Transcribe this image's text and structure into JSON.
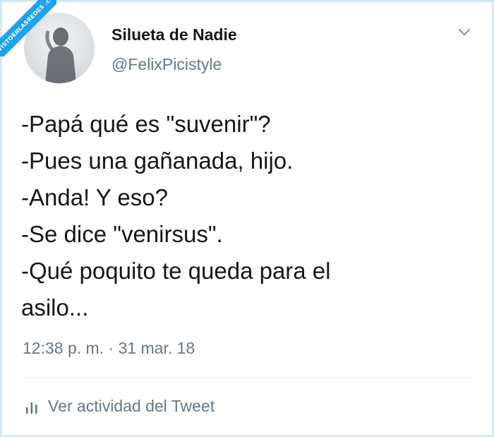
{
  "watermark": {
    "text": "VISTOENLASREDES .com"
  },
  "tweet": {
    "author_name": "Silueta de Nadie",
    "author_handle": "@FelixPicistyle",
    "lines": [
      "-Papá qué es \"suvenir\"?",
      "-Pues una gañanada, hijo.",
      "-Anda! Y eso?",
      "-Se dice \"venirsus\".",
      "-Qué poquito te queda para el",
      "asilo..."
    ],
    "timestamp": "12:38 p. m. · 31 mar. 18",
    "activity_label": "Ver actividad del Tweet",
    "menu_icon": "chevron-down-icon",
    "activity_icon": "analytics-bars-icon"
  },
  "colors": {
    "text_primary": "#14171a",
    "text_secondary": "#657786",
    "frame_border": "#d3e8f5",
    "divider": "#e6ecf0",
    "watermark_bg": "#1da1f2"
  }
}
